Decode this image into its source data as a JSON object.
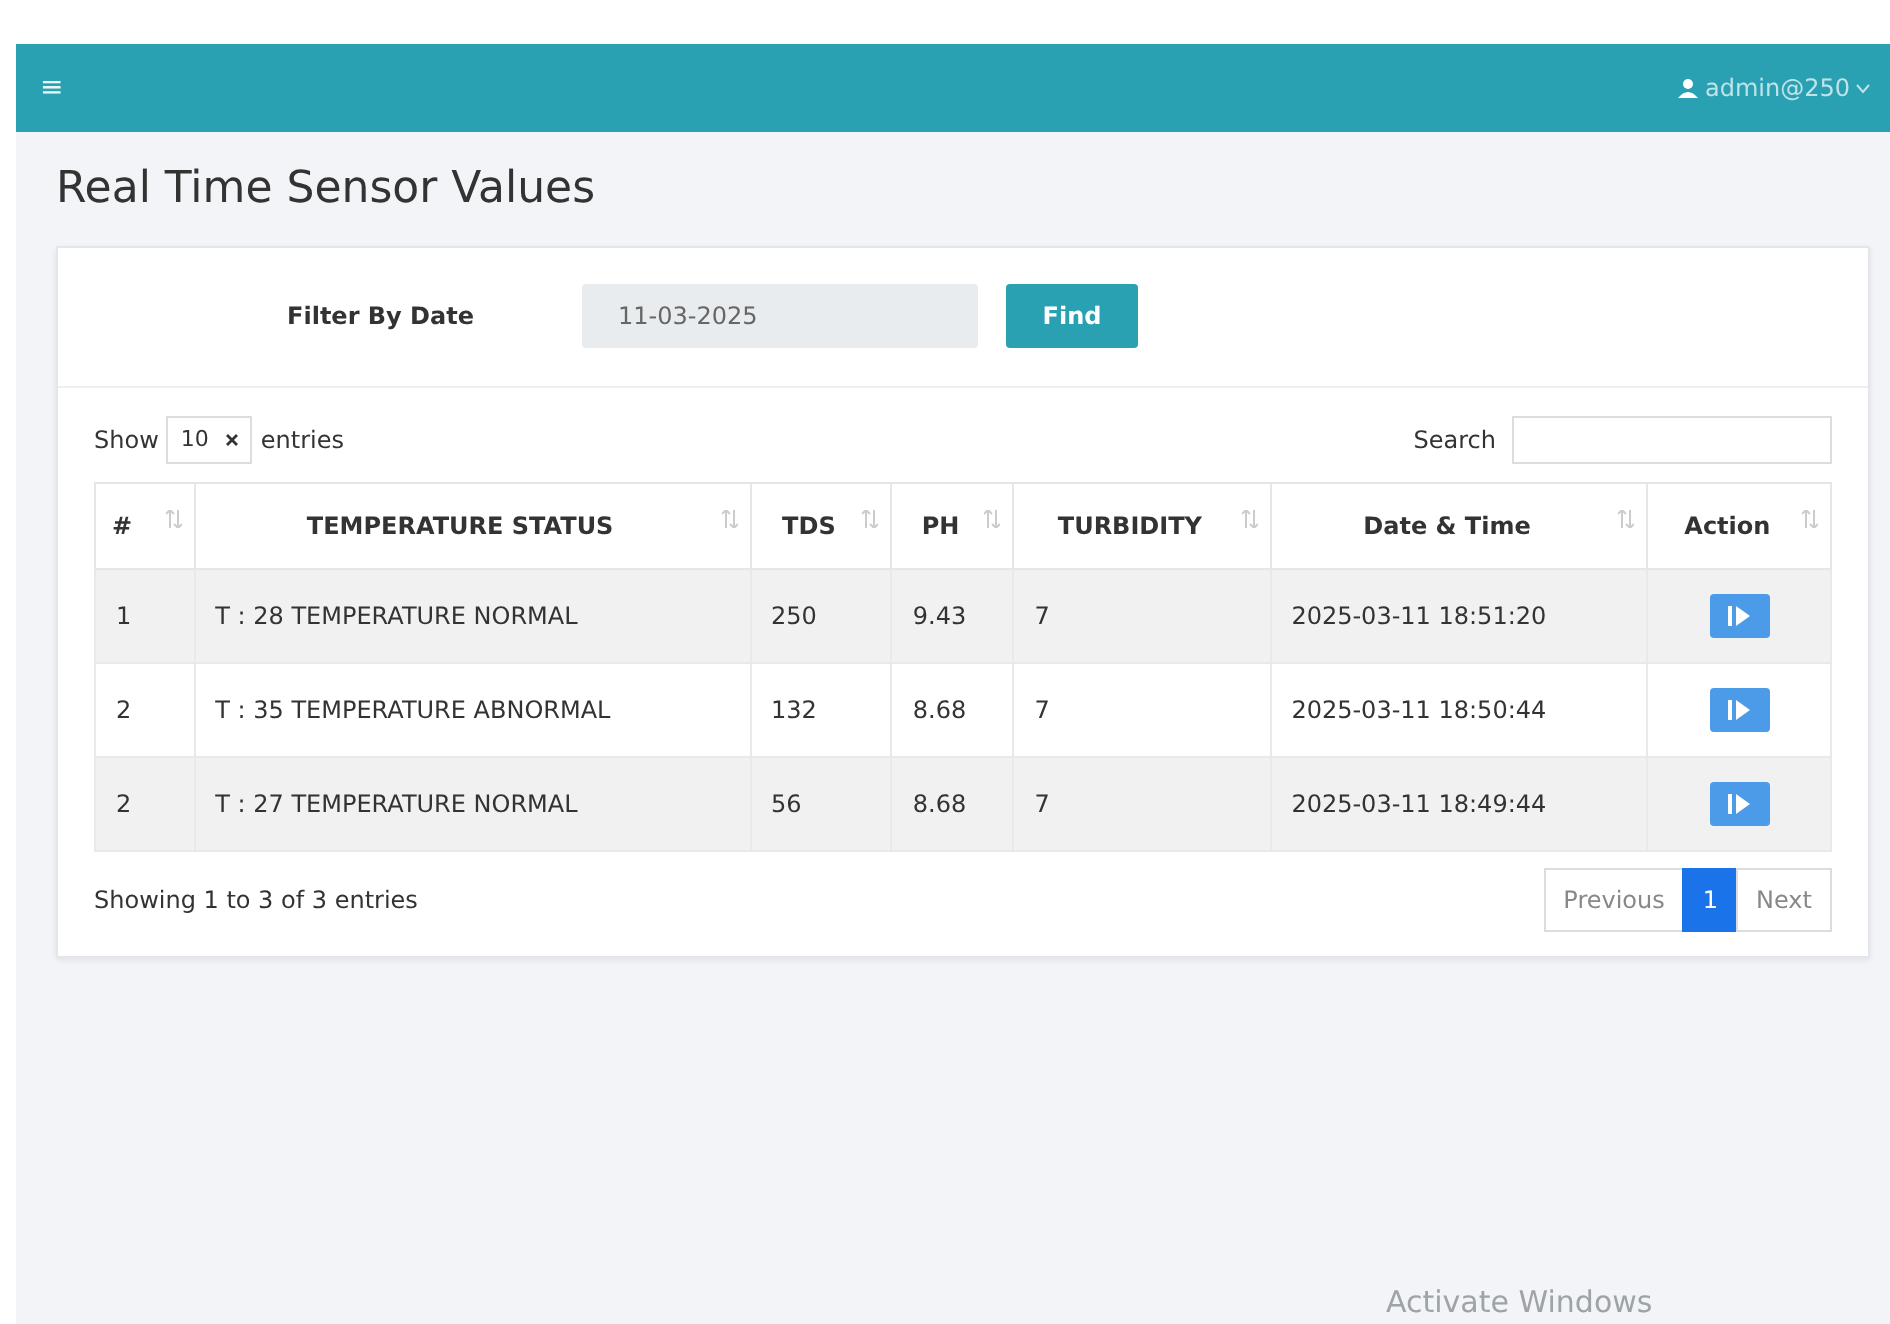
{
  "navbar": {
    "menu_icon": "≡",
    "user": "admin@250"
  },
  "title": "Real Time Sensor Values",
  "filter": {
    "label": "Filter By Date",
    "value": "11-03-2025",
    "button": "Find"
  },
  "table_controls": {
    "show_label": "Show",
    "page_size": "10",
    "entries_label": "entries",
    "search_label": "Search"
  },
  "table": {
    "columns": [
      "#",
      "TEMPERATURE STATUS",
      "TDS",
      "PH",
      "TURBIDITY",
      "Date & Time",
      "Action"
    ],
    "rows": [
      {
        "cells": [
          "1",
          "T : 28 TEMPERATURE NORMAL",
          "250",
          "9.43",
          "7",
          "2025-03-11 18:51:20"
        ]
      },
      {
        "cells": [
          "2",
          "T : 35 TEMPERATURE ABNORMAL",
          "132",
          "8.68",
          "7",
          "2025-03-11 18:50:44"
        ]
      },
      {
        "cells": [
          "2",
          "T : 27 TEMPERATURE NORMAL",
          "56",
          "8.68",
          "7",
          "2025-03-11 18:49:44"
        ]
      }
    ]
  },
  "footer": {
    "info": "Showing 1 to 3 of 3 entries",
    "pagination": [
      {
        "label": "Previous",
        "selected": false
      },
      {
        "label": "1",
        "selected": true
      },
      {
        "label": "Next",
        "selected": false
      }
    ]
  },
  "os_overlay": "Activate Windows"
}
